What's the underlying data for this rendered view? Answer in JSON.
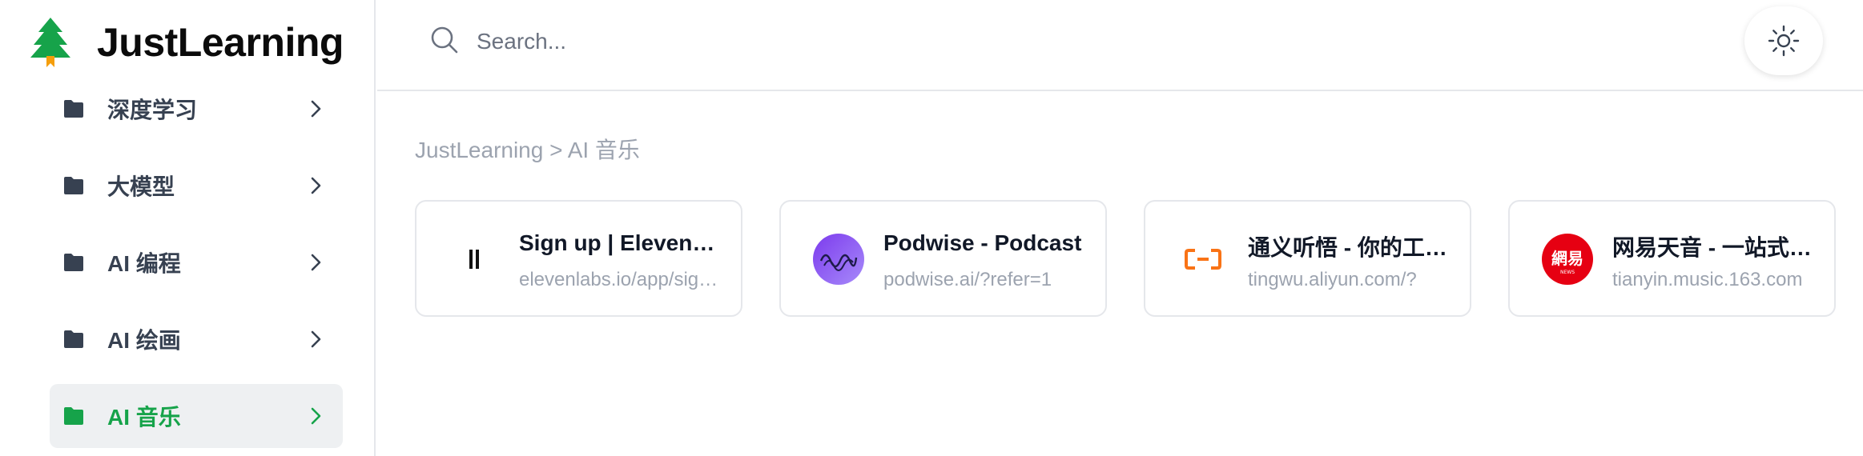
{
  "app": {
    "name": "JustLearning"
  },
  "colors": {
    "accent": "#16a34a",
    "folder": "#374151",
    "muted": "#9ca3af"
  },
  "sidebar": {
    "items": [
      {
        "label": "深度学习",
        "icon": "folder-icon",
        "active": false
      },
      {
        "label": "大模型",
        "icon": "folder-icon",
        "active": false
      },
      {
        "label": "AI 编程",
        "icon": "folder-icon",
        "active": false
      },
      {
        "label": "AI 绘画",
        "icon": "folder-icon",
        "active": false
      },
      {
        "label": "AI 音乐",
        "icon": "folder-icon",
        "active": true
      }
    ]
  },
  "search": {
    "placeholder": "Search...",
    "value": ""
  },
  "theme_toggle": {
    "icon": "sun-icon"
  },
  "breadcrumb": {
    "text": "JustLearning > AI 音乐"
  },
  "cards": [
    {
      "title": "Sign up | ElevenLabs",
      "url": "elevenlabs.io/app/sign-up",
      "icon": "elevenlabs-icon"
    },
    {
      "title": "Podwise - Podcast",
      "url": "podwise.ai/?refer=1",
      "icon": "podwise-icon"
    },
    {
      "title": "通义听悟 - 你的工作学习AI助手",
      "url": "tingwu.aliyun.com/?",
      "icon": "aliyun-icon"
    },
    {
      "title": "网易天音 - 一站式AI音乐创作",
      "url": "tianyin.music.163.com",
      "icon": "netease-icon",
      "icon_text": "網易",
      "icon_subtext": "NEWS"
    }
  ]
}
